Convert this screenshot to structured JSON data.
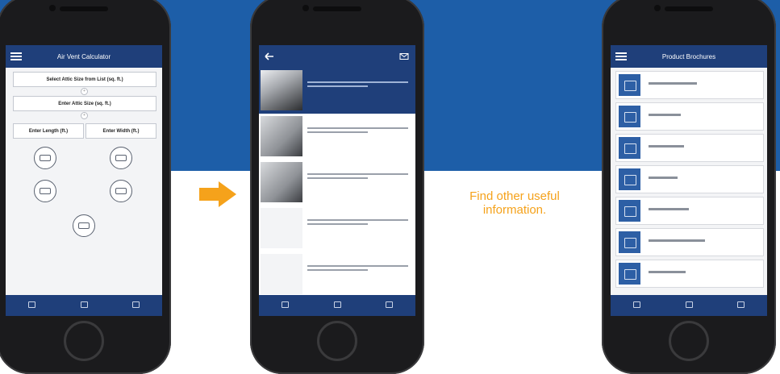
{
  "colors": {
    "brand_blue": "#1d5ea8",
    "app_bar": "#1f3f7a",
    "accent_orange": "#f5a21b"
  },
  "caption": {
    "text": "Find other useful information."
  },
  "phone1": {
    "appbar": {
      "title": "Air Vent Calculator",
      "menu_icon": "hamburger-icon"
    },
    "fields": {
      "select_attic": "Select Attic Size from List (sq. ft.)",
      "enter_attic": "Enter Attic Size (sq. ft.)",
      "enter_length": "Enter Length (ft.)",
      "enter_width": "Enter Width (ft.)"
    },
    "vents": [
      {
        "label": "",
        "icon": "ridge-vent-icon"
      },
      {
        "label": "",
        "icon": "roof-vent-icon"
      },
      {
        "label": "",
        "icon": "power-fan-icon"
      },
      {
        "label": "",
        "icon": "wind-turbine-icon"
      },
      {
        "label": "",
        "icon": "roof-louver-icon"
      }
    ]
  },
  "phone2": {
    "appbar": {
      "title": "",
      "back_icon": "back-arrow-icon",
      "mail_icon": "mail-icon"
    },
    "products": [
      {
        "name": "",
        "values": [
          "",
          "",
          ""
        ],
        "selected": true
      },
      {
        "name": "",
        "values": [
          "",
          "",
          ""
        ],
        "selected": false
      },
      {
        "name": "",
        "values": [
          "",
          "",
          ""
        ],
        "selected": false
      },
      {
        "name": "",
        "values": [
          "",
          "",
          ""
        ],
        "selected": false
      },
      {
        "name": "",
        "values": [
          "",
          "",
          ""
        ],
        "selected": false
      }
    ]
  },
  "phone3": {
    "appbar": {
      "title": "Product Brochures",
      "menu_icon": "hamburger-icon"
    },
    "brochures": [
      {
        "icon": "brochure-icon",
        "label": ""
      },
      {
        "icon": "brochure-icon",
        "label": ""
      },
      {
        "icon": "brochure-icon",
        "label": ""
      },
      {
        "icon": "brochure-icon",
        "label": ""
      },
      {
        "icon": "brochure-icon",
        "label": ""
      },
      {
        "icon": "brochure-icon",
        "label": ""
      },
      {
        "icon": "brochure-icon",
        "label": ""
      }
    ]
  },
  "tabbar": [
    {
      "icon": "calculator-icon",
      "label": ""
    },
    {
      "icon": "home-icon",
      "label": ""
    },
    {
      "icon": "info-icon",
      "label": ""
    }
  ]
}
